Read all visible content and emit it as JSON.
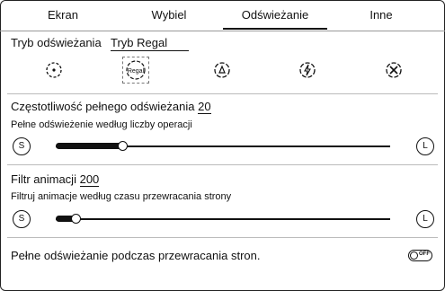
{
  "tabs": [
    {
      "label": "Ekran",
      "active": false
    },
    {
      "label": "Wybiel",
      "active": false
    },
    {
      "label": "Odświeżanie",
      "active": true
    },
    {
      "label": "Inne",
      "active": false
    }
  ],
  "refresh_mode": {
    "label": "Tryb odświeżania",
    "value": "Tryb Regal",
    "icons": [
      {
        "name": "normal-mode-icon",
        "selected": false
      },
      {
        "name": "regal-mode-icon",
        "label": "Regal",
        "selected": true
      },
      {
        "name": "fast-mode-icon",
        "selected": false
      },
      {
        "name": "a2-mode-icon",
        "selected": false
      },
      {
        "name": "x-mode-icon",
        "selected": false
      }
    ]
  },
  "full_refresh": {
    "label": "Częstotliwość pełnego odświeżania",
    "value": "20",
    "description": "Pełne odświeżenie według liczby operacji",
    "min_label": "S",
    "max_label": "L",
    "slider_fraction": 0.2
  },
  "animation_filter": {
    "label": "Filtr animacji",
    "value": "200",
    "description": "Filtruj animacje według czasu przewracania strony",
    "min_label": "S",
    "max_label": "L",
    "slider_fraction": 0.06
  },
  "page_turn_refresh": {
    "label": "Pełne odświeżanie podczas przewracania stron.",
    "toggle_text": "OFF",
    "enabled": false
  }
}
